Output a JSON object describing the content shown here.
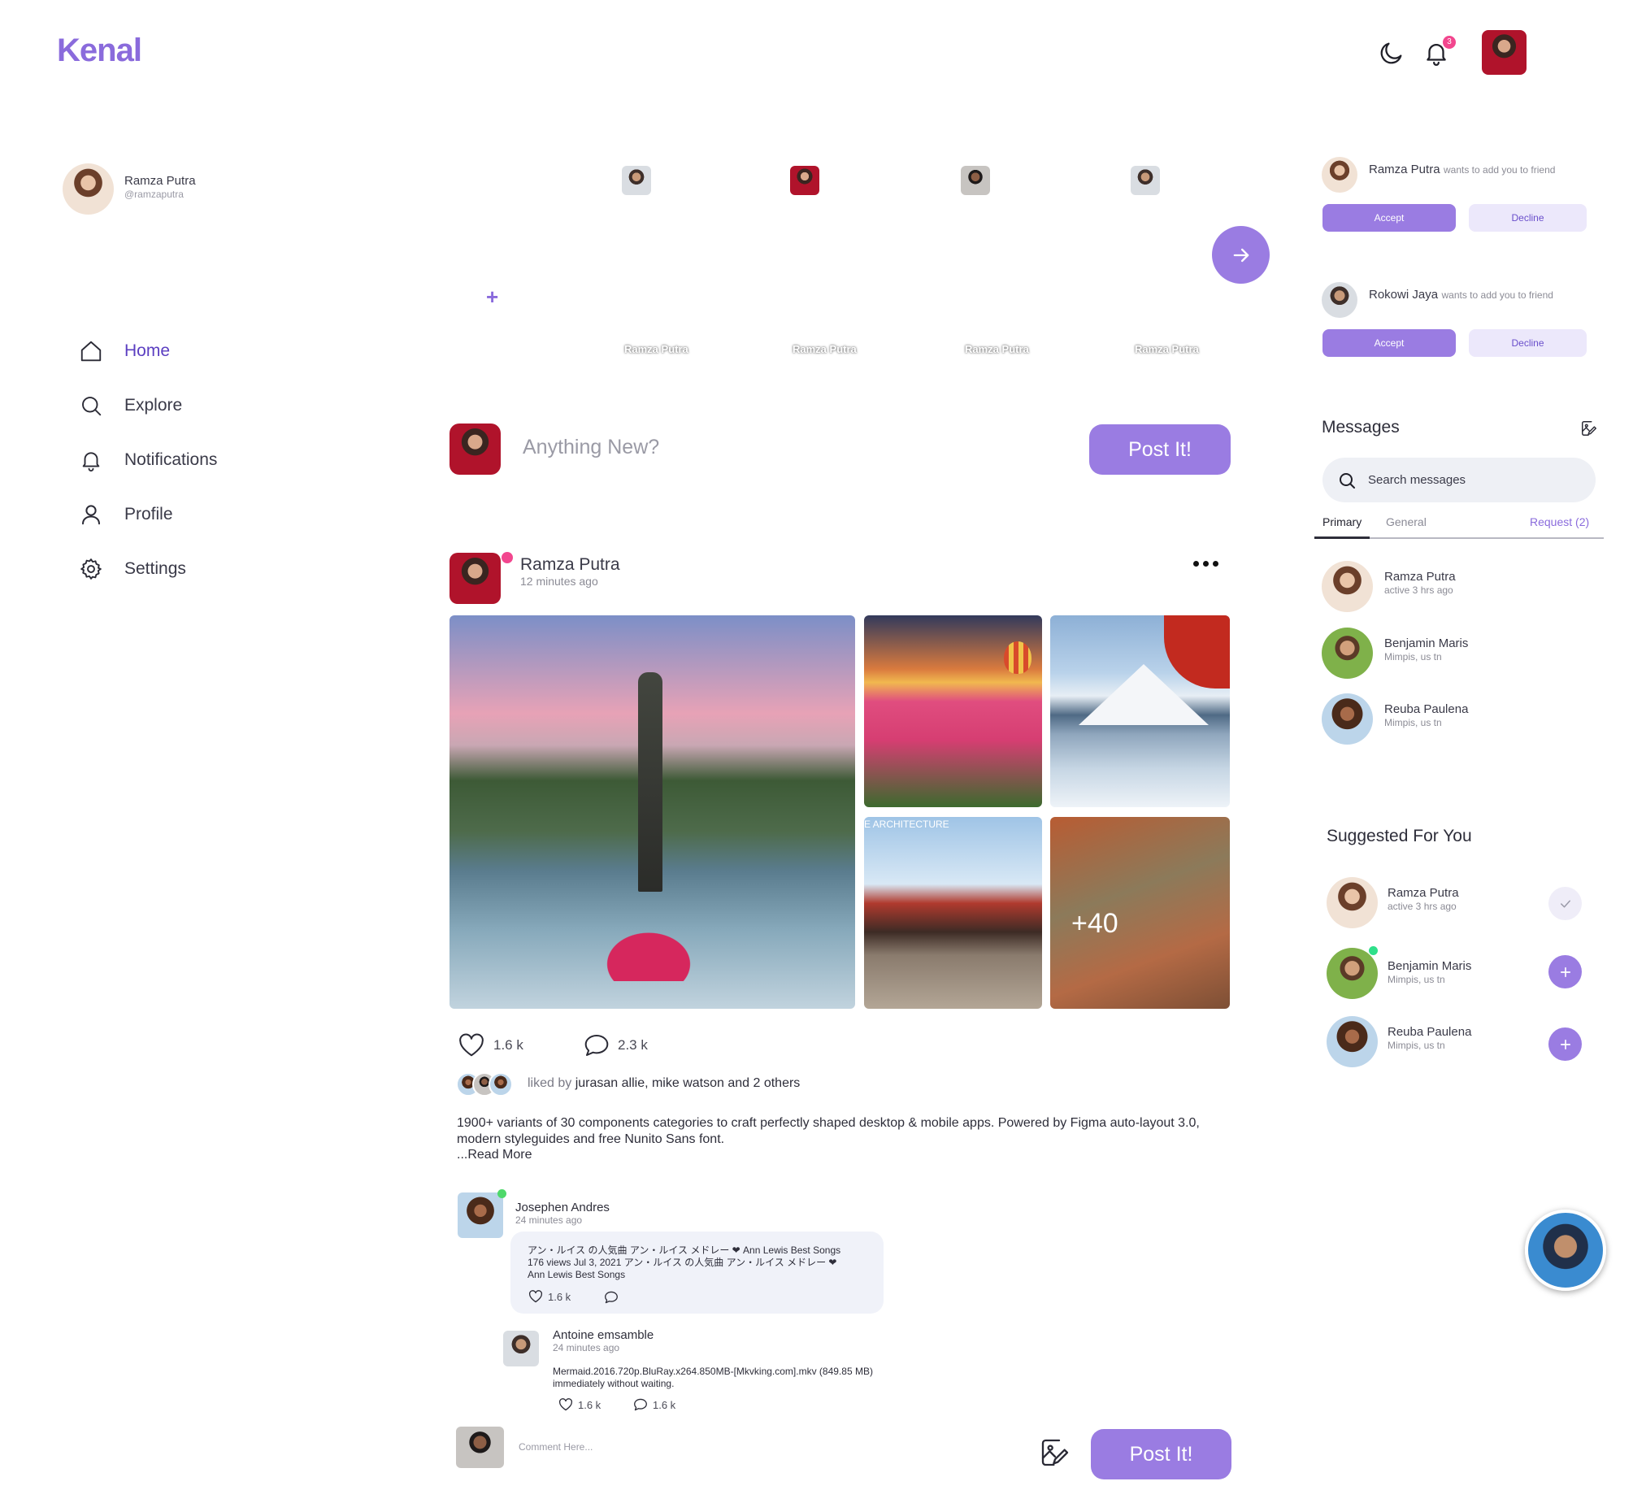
{
  "brand": {
    "logo": "Kenal",
    "accent": "#8a6bdc"
  },
  "header": {
    "notification_count": "3"
  },
  "profile_card": {
    "name": "Ramza Putra",
    "handle": "@ramzaputra"
  },
  "nav": {
    "items": [
      {
        "label": "Home",
        "icon": "home-icon",
        "active": true
      },
      {
        "label": "Explore",
        "icon": "search-icon",
        "active": false
      },
      {
        "label": "Notifications",
        "icon": "bell-icon",
        "active": false
      },
      {
        "label": "Profile",
        "icon": "user-icon",
        "active": false
      },
      {
        "label": "Settings",
        "icon": "gear-icon",
        "active": false
      }
    ]
  },
  "stories": {
    "add_symbol": "+",
    "items": [
      {
        "name": "Ramza Putra"
      },
      {
        "name": "Ramza Putra"
      },
      {
        "name": "Ramza Putra"
      },
      {
        "name": "Ramza Putra"
      }
    ]
  },
  "composer": {
    "placeholder": "Anything New?",
    "post_label": "Post It!"
  },
  "post": {
    "author": "Ramza Putra",
    "time": "12 minutes ago",
    "more_overflow": "+40",
    "architecture_caption": "E ARCHITECTURE",
    "likes": "1.6 k",
    "comments": "2.3 k",
    "liked_by_prefix": "liked by ",
    "liked_by_names": "jurasan allie, mike watson and 2 others",
    "caption": "1900+ variants of 30 components categories to craft perfectly shaped desktop & mobile apps. Powered by Figma auto-layout 3.0, modern styleguides and free Nunito Sans font.",
    "read_more": "...Read More"
  },
  "comments": [
    {
      "author": "Josephen Andres",
      "time": "24 minutes ago",
      "text_line1": "アン・ルイス の人気曲 アン・ルイス メドレー ❤ Ann Lewis Best Songs",
      "text_line2": "176 views  Jul 3, 2021  アン・ルイス の人気曲 アン・ルイス メドレー ❤",
      "text_line3": "Ann Lewis Best Songs",
      "likes": "1.6 k"
    },
    {
      "author": "Antoine emsamble",
      "time": "24 minutes ago",
      "text_line1": "Mermaid.2016.720p.BluRay.x264.850MB-[Mkvking.com].mkv (849.85 MB)",
      "text_line2": "immediately without waiting.",
      "likes": "1.6 k",
      "replies": "1.6 k"
    }
  ],
  "comment_box": {
    "placeholder": "Comment Here...",
    "post_label": "Post It!"
  },
  "friend_requests": [
    {
      "name": "Ramza Putra",
      "message": "wants to add you to friend",
      "accept": "Accept",
      "decline": "Decline"
    },
    {
      "name": "Rokowi Jaya",
      "message": "wants to add you to friend",
      "accept": "Accept",
      "decline": "Decline"
    }
  ],
  "messages": {
    "title": "Messages",
    "search_placeholder": "Search messages",
    "tabs": {
      "primary": "Primary",
      "general": "General",
      "request": "Request (2)"
    },
    "items": [
      {
        "name": "Ramza Putra",
        "status": "active 3 hrs ago"
      },
      {
        "name": "Benjamin Maris",
        "status": "Mimpis, us tn"
      },
      {
        "name": "Reuba Paulena",
        "status": "Mimpis, us tn"
      }
    ]
  },
  "suggested": {
    "title": "Suggested For You",
    "items": [
      {
        "name": "Ramza Putra",
        "status": "active 3 hrs ago",
        "action": "check"
      },
      {
        "name": "Benjamin Maris",
        "status": "Mimpis, us tn",
        "action": "add"
      },
      {
        "name": "Reuba Paulena",
        "status": "Mimpis, us tn",
        "action": "add"
      }
    ]
  }
}
